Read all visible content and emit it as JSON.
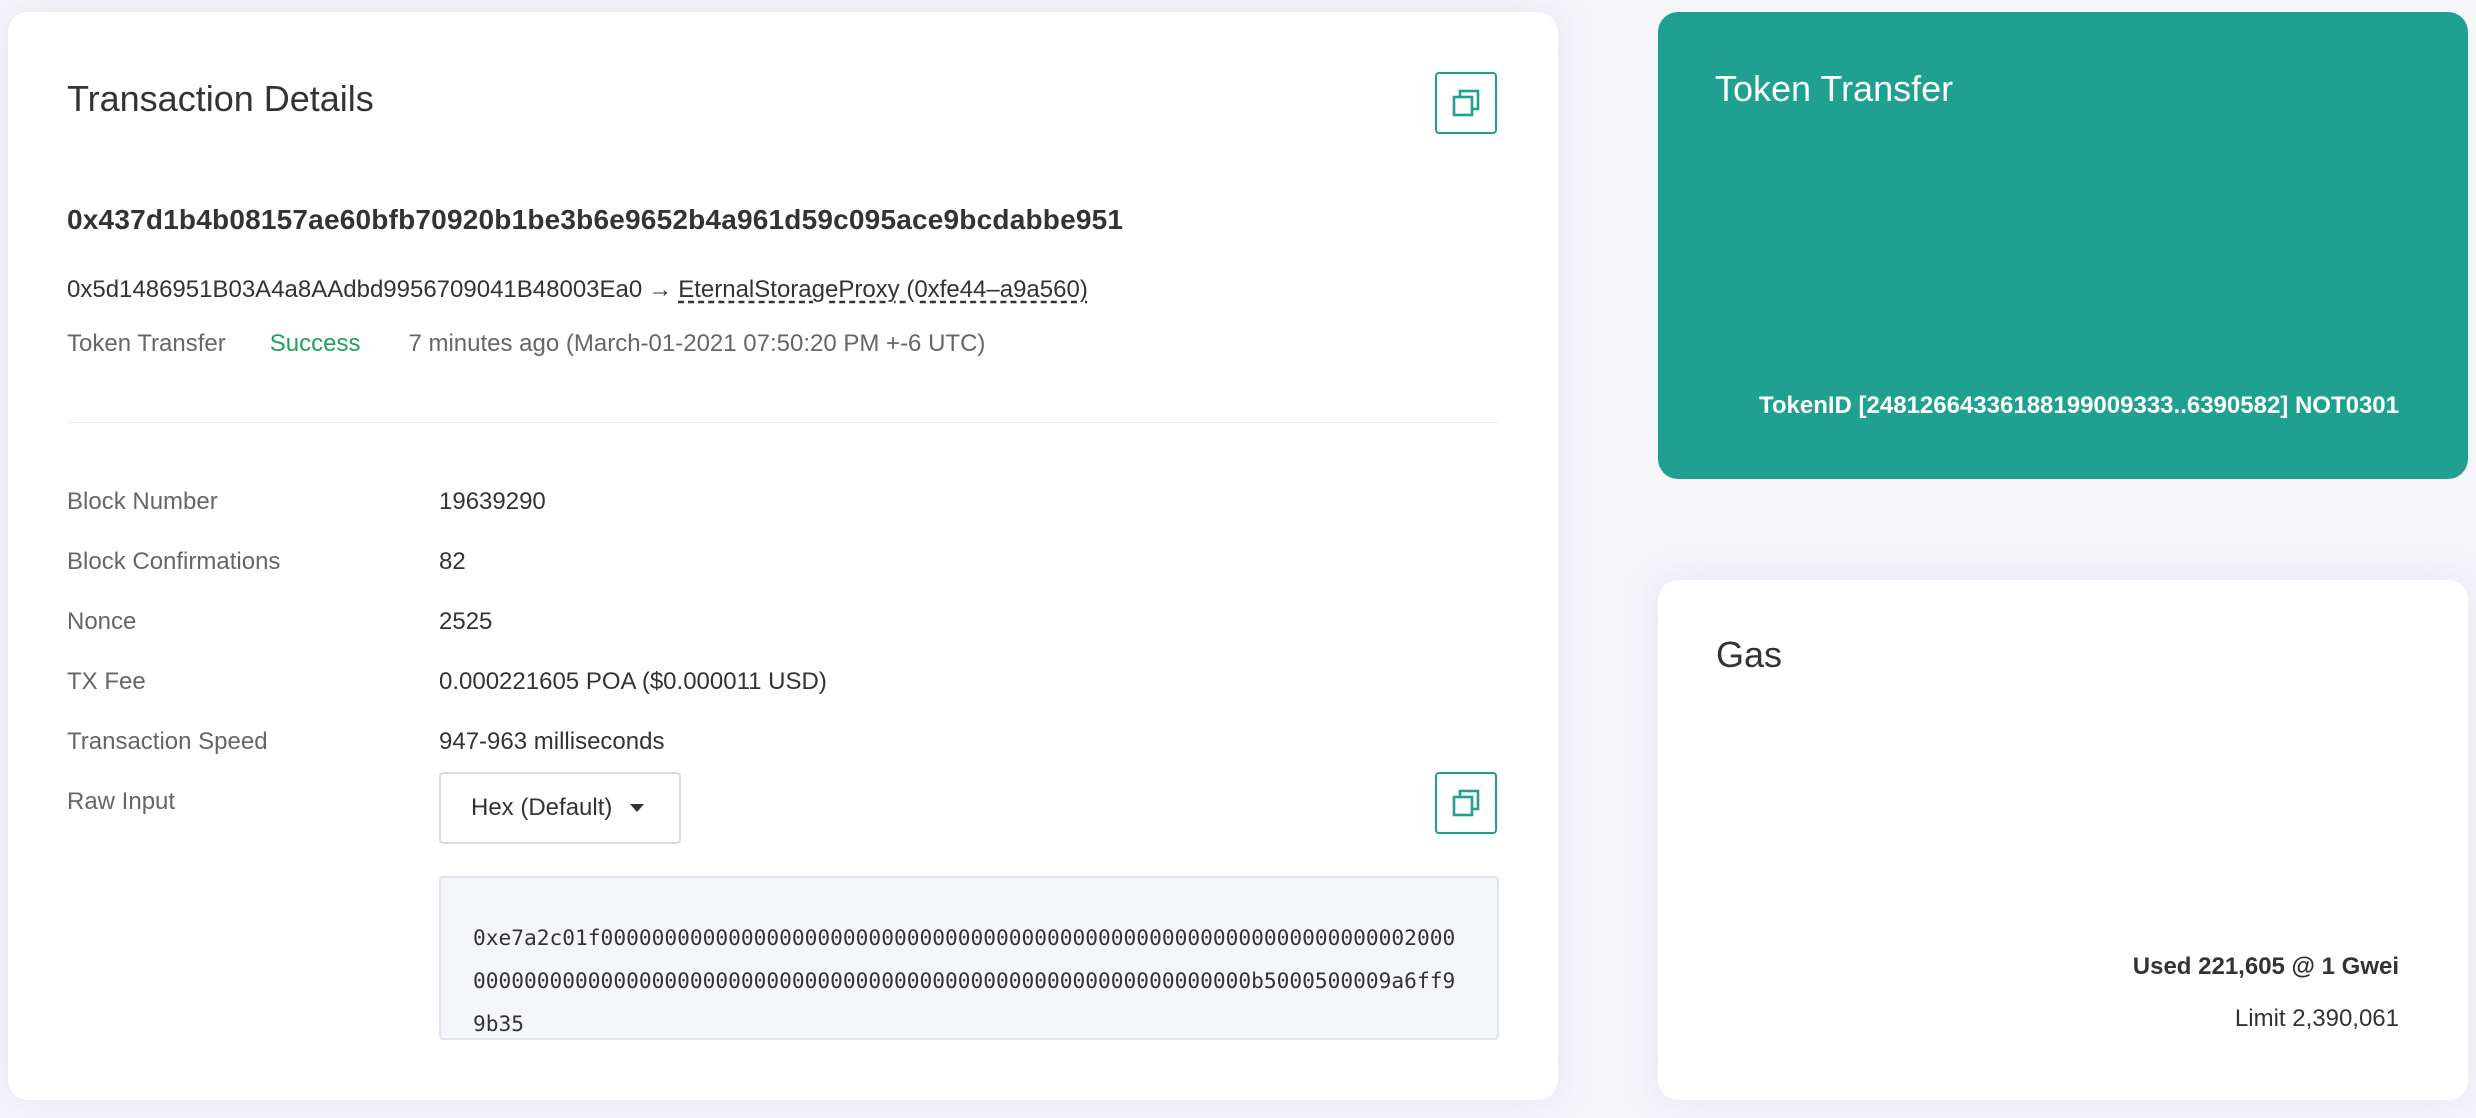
{
  "transaction": {
    "title": "Transaction Details",
    "hash": "0x437d1b4b08157ae60bfb70920b1be3b6e9652b4a961d59c095ace9bcdabbe951",
    "from": "0x5d1486951B03A4a8AAdbd9956709041B48003Ea0",
    "arrow": "→",
    "to": "EternalStorageProxy (0xfe44–a9a560)",
    "type": "Token Transfer",
    "status": "Success",
    "time": "7 minutes ago (March-01-2021 07:50:20 PM +-6 UTC)"
  },
  "details": {
    "block_number_label": "Block Number",
    "block_number": "19639290",
    "confirmations_label": "Block Confirmations",
    "confirmations": "82",
    "nonce_label": "Nonce",
    "nonce": "2525",
    "fee_label": "TX Fee",
    "fee": "0.000221605 POA ($0.000011 USD)",
    "speed_label": "Transaction Speed",
    "speed": "947-963 milliseconds",
    "raw_input_label": "Raw Input",
    "raw_format": "Hex (Default)",
    "raw_input": "0xe7a2c01f00000000000000000000000000000000000000000000000000000000000000020000000000000000000000000000000000000000000000000000000000000000b5000500009a6ff99b35"
  },
  "token_transfer": {
    "title": "Token Transfer",
    "token_id": "TokenID [2481266433618819900933​3..6390582] NOT0301"
  },
  "gas": {
    "title": "Gas",
    "used": "Used 221,605 @ 1 Gwei",
    "limit": "Limit 2,390,061"
  },
  "colors": {
    "accent": "#20a091",
    "success": "#20a05a",
    "background": "#f5f5fa"
  },
  "icons": {
    "copy": "copy-icon",
    "caret": "chevron-down-icon"
  }
}
